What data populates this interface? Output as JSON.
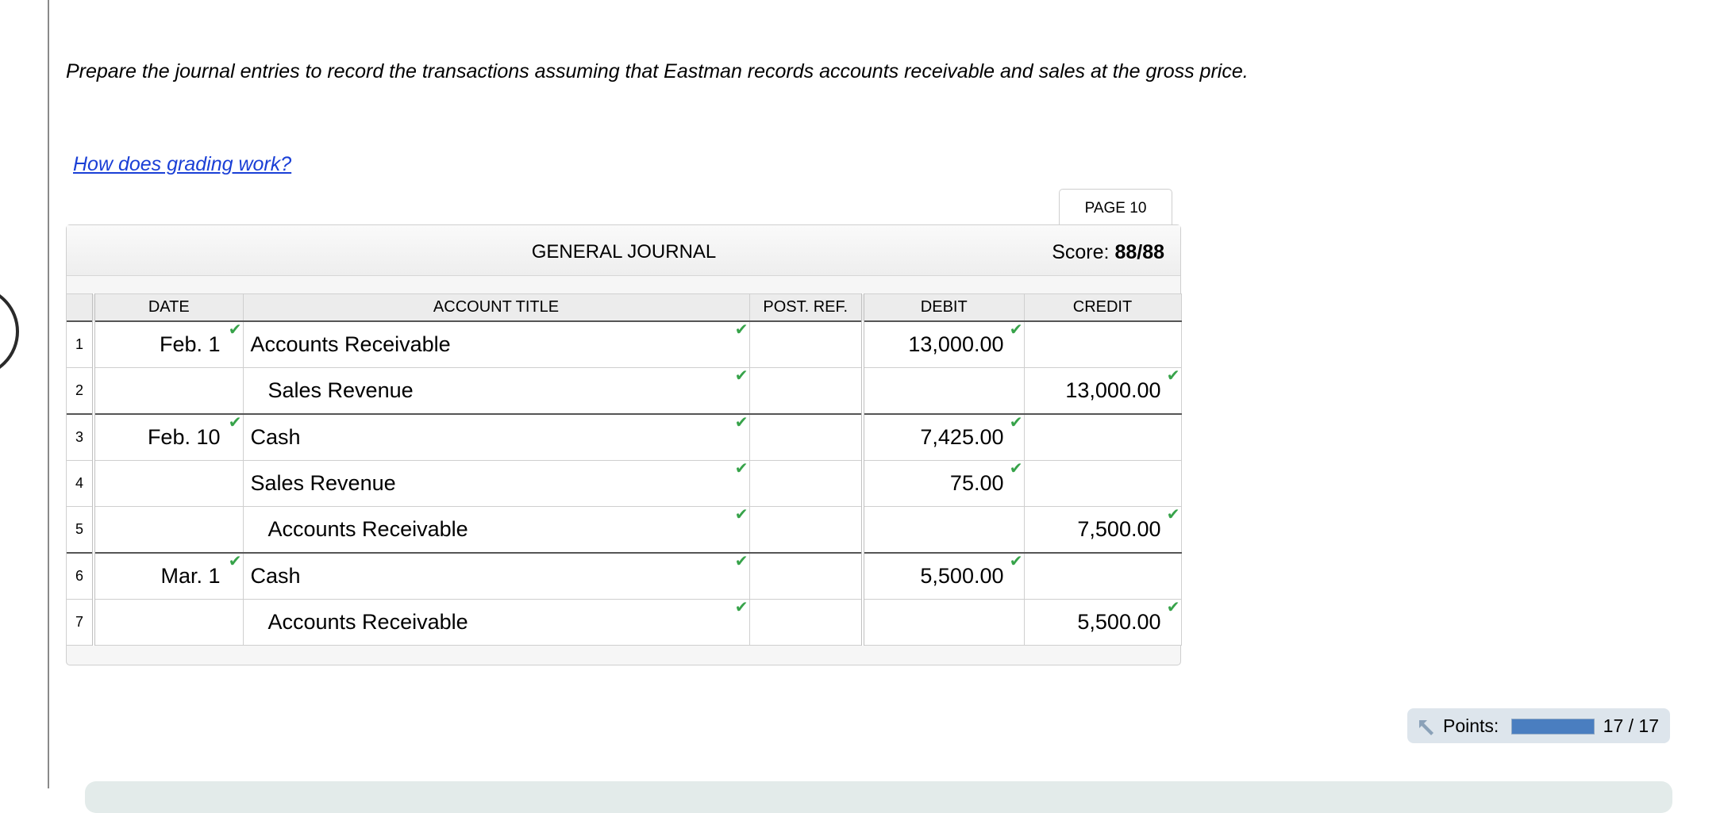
{
  "instructions": "Prepare the journal entries to record the transactions assuming that Eastman records accounts receivable and sales at the gross price.",
  "grading_link": "How does grading work?",
  "page_tab": "PAGE 10",
  "journal": {
    "title": "GENERAL JOURNAL",
    "score_label": "Score:",
    "score_value": "88/88",
    "columns": {
      "date": "DATE",
      "account": "ACCOUNT TITLE",
      "postref": "POST. REF.",
      "debit": "DEBIT",
      "credit": "CREDIT"
    },
    "rows": [
      {
        "num": "1",
        "date": "Feb. 1",
        "account": "Accounts Receivable",
        "indent": false,
        "postref": "",
        "debit": "13,000.00",
        "credit": ""
      },
      {
        "num": "2",
        "date": "",
        "account": "Sales Revenue",
        "indent": true,
        "postref": "",
        "debit": "",
        "credit": "13,000.00"
      },
      {
        "num": "3",
        "date": "Feb. 10",
        "account": "Cash",
        "indent": false,
        "postref": "",
        "debit": "7,425.00",
        "credit": ""
      },
      {
        "num": "4",
        "date": "",
        "account": "Sales Revenue",
        "indent": false,
        "postref": "",
        "debit": "75.00",
        "credit": ""
      },
      {
        "num": "5",
        "date": "",
        "account": "Accounts Receivable",
        "indent": true,
        "postref": "",
        "debit": "",
        "credit": "7,500.00"
      },
      {
        "num": "6",
        "date": "Mar. 1",
        "account": "Cash",
        "indent": false,
        "postref": "",
        "debit": "5,500.00",
        "credit": ""
      },
      {
        "num": "7",
        "date": "",
        "account": "Accounts Receivable",
        "indent": true,
        "postref": "",
        "debit": "",
        "credit": "5,500.00"
      }
    ]
  },
  "points": {
    "label": "Points:",
    "value": "17 / 17",
    "earned": 17,
    "total": 17
  },
  "colors": {
    "check": "#37a34a",
    "link": "#1a3fd6",
    "points_bar": "#4a7ec0"
  },
  "icons": {
    "check": "checkmark-icon",
    "points": "points-arrow-icon"
  }
}
